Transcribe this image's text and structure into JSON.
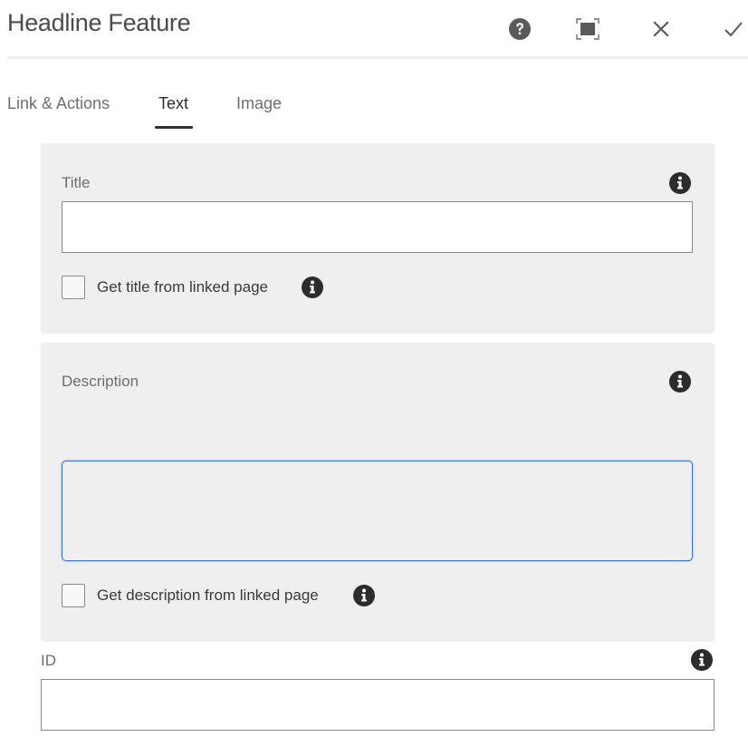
{
  "dialog": {
    "title": "Headline Feature",
    "actions": {
      "help": "help-icon",
      "fullscreen": "fullscreen-icon",
      "cancel": "close-icon",
      "done": "checkmark-icon"
    }
  },
  "tabs": [
    {
      "label": "Link & Actions",
      "active": false
    },
    {
      "label": "Text",
      "active": true
    },
    {
      "label": "Image",
      "active": false
    }
  ],
  "fields": {
    "title": {
      "label": "Title",
      "value": "",
      "info_icon": "info-icon",
      "checkbox_label": "Get title from linked page",
      "checkbox_checked": false
    },
    "description": {
      "label": "Description",
      "value": "",
      "info_icon": "info-icon",
      "checkbox_label": "Get description from linked page",
      "checkbox_checked": false
    },
    "id": {
      "label": "ID",
      "value": "",
      "info_icon": "info-icon"
    }
  },
  "colors": {
    "focus_border": "#3a73c8",
    "panel_bg": "#efefef",
    "icon_dark": "#2c2c2c"
  }
}
